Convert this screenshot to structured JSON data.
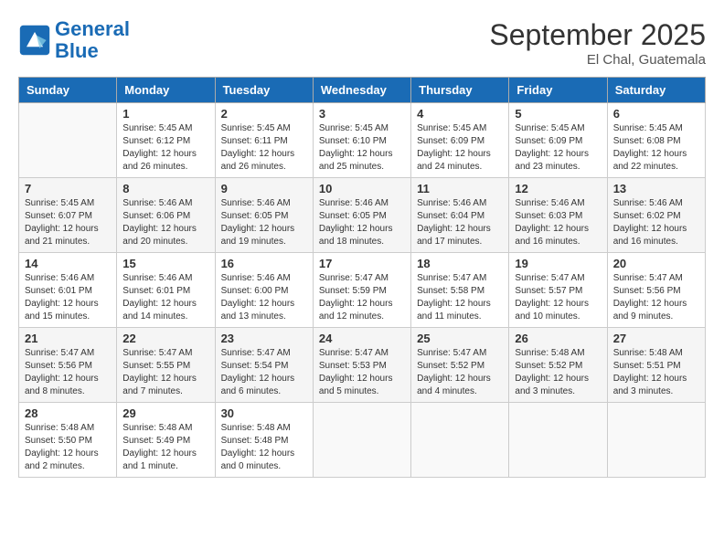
{
  "header": {
    "logo_line1": "General",
    "logo_line2": "Blue",
    "month": "September 2025",
    "location": "El Chal, Guatemala"
  },
  "days_of_week": [
    "Sunday",
    "Monday",
    "Tuesday",
    "Wednesday",
    "Thursday",
    "Friday",
    "Saturday"
  ],
  "weeks": [
    [
      {
        "num": "",
        "info": ""
      },
      {
        "num": "1",
        "info": "Sunrise: 5:45 AM\nSunset: 6:12 PM\nDaylight: 12 hours\nand 26 minutes."
      },
      {
        "num": "2",
        "info": "Sunrise: 5:45 AM\nSunset: 6:11 PM\nDaylight: 12 hours\nand 26 minutes."
      },
      {
        "num": "3",
        "info": "Sunrise: 5:45 AM\nSunset: 6:10 PM\nDaylight: 12 hours\nand 25 minutes."
      },
      {
        "num": "4",
        "info": "Sunrise: 5:45 AM\nSunset: 6:09 PM\nDaylight: 12 hours\nand 24 minutes."
      },
      {
        "num": "5",
        "info": "Sunrise: 5:45 AM\nSunset: 6:09 PM\nDaylight: 12 hours\nand 23 minutes."
      },
      {
        "num": "6",
        "info": "Sunrise: 5:45 AM\nSunset: 6:08 PM\nDaylight: 12 hours\nand 22 minutes."
      }
    ],
    [
      {
        "num": "7",
        "info": "Sunrise: 5:45 AM\nSunset: 6:07 PM\nDaylight: 12 hours\nand 21 minutes."
      },
      {
        "num": "8",
        "info": "Sunrise: 5:46 AM\nSunset: 6:06 PM\nDaylight: 12 hours\nand 20 minutes."
      },
      {
        "num": "9",
        "info": "Sunrise: 5:46 AM\nSunset: 6:05 PM\nDaylight: 12 hours\nand 19 minutes."
      },
      {
        "num": "10",
        "info": "Sunrise: 5:46 AM\nSunset: 6:05 PM\nDaylight: 12 hours\nand 18 minutes."
      },
      {
        "num": "11",
        "info": "Sunrise: 5:46 AM\nSunset: 6:04 PM\nDaylight: 12 hours\nand 17 minutes."
      },
      {
        "num": "12",
        "info": "Sunrise: 5:46 AM\nSunset: 6:03 PM\nDaylight: 12 hours\nand 16 minutes."
      },
      {
        "num": "13",
        "info": "Sunrise: 5:46 AM\nSunset: 6:02 PM\nDaylight: 12 hours\nand 16 minutes."
      }
    ],
    [
      {
        "num": "14",
        "info": "Sunrise: 5:46 AM\nSunset: 6:01 PM\nDaylight: 12 hours\nand 15 minutes."
      },
      {
        "num": "15",
        "info": "Sunrise: 5:46 AM\nSunset: 6:01 PM\nDaylight: 12 hours\nand 14 minutes."
      },
      {
        "num": "16",
        "info": "Sunrise: 5:46 AM\nSunset: 6:00 PM\nDaylight: 12 hours\nand 13 minutes."
      },
      {
        "num": "17",
        "info": "Sunrise: 5:47 AM\nSunset: 5:59 PM\nDaylight: 12 hours\nand 12 minutes."
      },
      {
        "num": "18",
        "info": "Sunrise: 5:47 AM\nSunset: 5:58 PM\nDaylight: 12 hours\nand 11 minutes."
      },
      {
        "num": "19",
        "info": "Sunrise: 5:47 AM\nSunset: 5:57 PM\nDaylight: 12 hours\nand 10 minutes."
      },
      {
        "num": "20",
        "info": "Sunrise: 5:47 AM\nSunset: 5:56 PM\nDaylight: 12 hours\nand 9 minutes."
      }
    ],
    [
      {
        "num": "21",
        "info": "Sunrise: 5:47 AM\nSunset: 5:56 PM\nDaylight: 12 hours\nand 8 minutes."
      },
      {
        "num": "22",
        "info": "Sunrise: 5:47 AM\nSunset: 5:55 PM\nDaylight: 12 hours\nand 7 minutes."
      },
      {
        "num": "23",
        "info": "Sunrise: 5:47 AM\nSunset: 5:54 PM\nDaylight: 12 hours\nand 6 minutes."
      },
      {
        "num": "24",
        "info": "Sunrise: 5:47 AM\nSunset: 5:53 PM\nDaylight: 12 hours\nand 5 minutes."
      },
      {
        "num": "25",
        "info": "Sunrise: 5:47 AM\nSunset: 5:52 PM\nDaylight: 12 hours\nand 4 minutes."
      },
      {
        "num": "26",
        "info": "Sunrise: 5:48 AM\nSunset: 5:52 PM\nDaylight: 12 hours\nand 3 minutes."
      },
      {
        "num": "27",
        "info": "Sunrise: 5:48 AM\nSunset: 5:51 PM\nDaylight: 12 hours\nand 3 minutes."
      }
    ],
    [
      {
        "num": "28",
        "info": "Sunrise: 5:48 AM\nSunset: 5:50 PM\nDaylight: 12 hours\nand 2 minutes."
      },
      {
        "num": "29",
        "info": "Sunrise: 5:48 AM\nSunset: 5:49 PM\nDaylight: 12 hours\nand 1 minute."
      },
      {
        "num": "30",
        "info": "Sunrise: 5:48 AM\nSunset: 5:48 PM\nDaylight: 12 hours\nand 0 minutes."
      },
      {
        "num": "",
        "info": ""
      },
      {
        "num": "",
        "info": ""
      },
      {
        "num": "",
        "info": ""
      },
      {
        "num": "",
        "info": ""
      }
    ]
  ]
}
